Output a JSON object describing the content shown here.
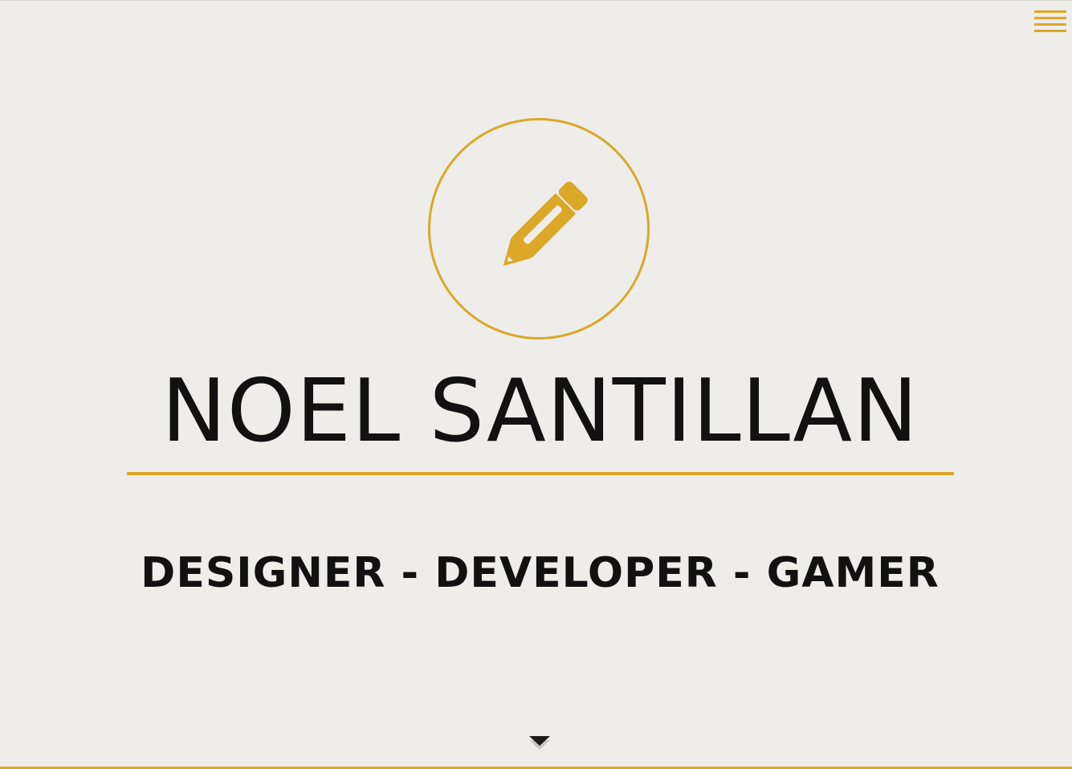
{
  "header": {
    "menu_icon": "hamburger-menu-icon"
  },
  "hero": {
    "icon": "pencil-icon",
    "name": "NOEL SANTILLAN",
    "tagline": "DESIGNER - DEVELOPER - GAMER",
    "scroll_icon": "chevron-down-icon"
  },
  "colors": {
    "accent": "#dba726",
    "background": "#eeedea",
    "text": "#111111"
  }
}
